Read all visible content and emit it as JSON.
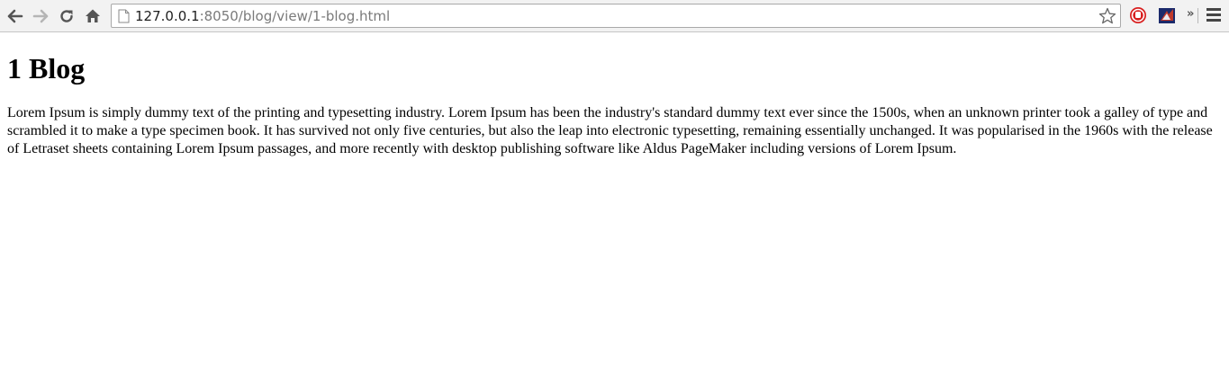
{
  "browser": {
    "url_host": "127.0.0.1",
    "url_rest": ":8050/blog/view/1-blog.html",
    "overflow_label": "»",
    "icons": {
      "back": "back-arrow-icon",
      "forward": "forward-arrow-icon",
      "reload": "reload-icon",
      "home": "home-icon",
      "page": "page-icon",
      "bookmark": "star-icon",
      "extension_1": "stop-extension-icon",
      "extension_2": "extension-icon",
      "menu": "menu-icon"
    },
    "colors": {
      "toolbar_bg": "#f2f2f2",
      "extension_red": "#d82020",
      "extension_navy": "#1b2a6b"
    }
  },
  "page": {
    "title": "1 Blog",
    "body": "Lorem Ipsum is simply dummy text of the printing and typesetting industry. Lorem Ipsum has been the industry's standard dummy text ever since the 1500s, when an unknown printer took a galley of type and scrambled it to make a type specimen book. It has survived not only five centuries, but also the leap into electronic typesetting, remaining essentially unchanged. It was popularised in the 1960s with the release of Letraset sheets containing Lorem Ipsum passages, and more recently with desktop publishing software like Aldus PageMaker including versions of Lorem Ipsum."
  }
}
